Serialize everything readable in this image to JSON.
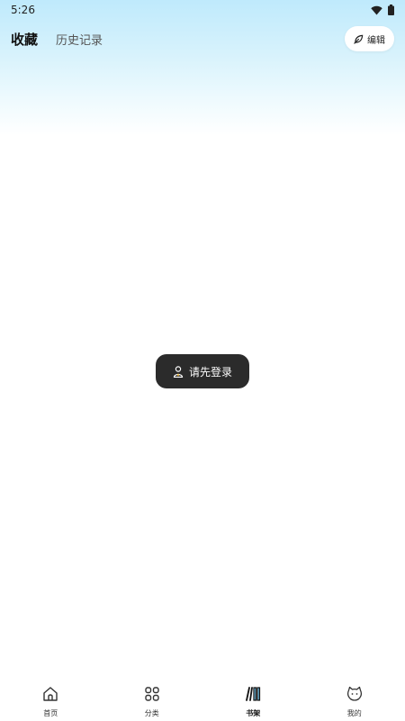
{
  "status_bar": {
    "time": "5:26",
    "icons": [
      "wifi-icon",
      "battery-icon"
    ]
  },
  "header": {
    "tabs": [
      {
        "label": "收藏",
        "active": true
      },
      {
        "label": "历史记录",
        "active": false
      }
    ],
    "edit_label": "编辑"
  },
  "toast": {
    "text": "请先登录",
    "icon": "user-icon"
  },
  "bottom_nav": {
    "items": [
      {
        "label": "首页",
        "icon": "home-icon",
        "active": false
      },
      {
        "label": "分类",
        "icon": "grid-icon",
        "active": false
      },
      {
        "label": "书架",
        "icon": "bookshelf-icon",
        "active": true
      },
      {
        "label": "我的",
        "icon": "cat-face-icon",
        "active": false
      }
    ]
  },
  "colors": {
    "header_gradient_top": "#bfeafc",
    "toast_bg": "#2b2b2b",
    "background": "#ffffff"
  }
}
